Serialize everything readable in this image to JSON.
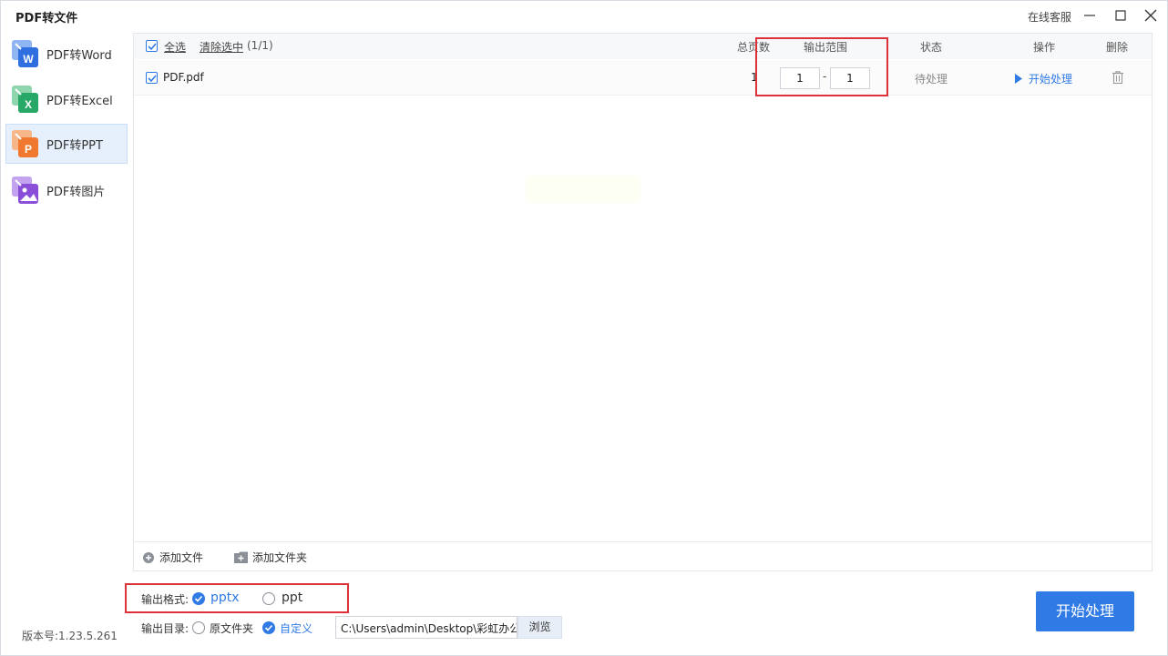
{
  "app": {
    "title": "PDF转文件",
    "support_label": "在线客服",
    "version": "版本号:1.23.5.261"
  },
  "sidebar": {
    "items": [
      {
        "label": "PDF转Word",
        "icon": "word-icon",
        "letter": "W",
        "color": "#2f6fe0",
        "active": false
      },
      {
        "label": "PDF转Excel",
        "icon": "excel-icon",
        "letter": "X",
        "color": "#27a866",
        "active": false
      },
      {
        "label": "PDF转PPT",
        "icon": "ppt-icon",
        "letter": "P",
        "color": "#f0792f",
        "active": true
      },
      {
        "label": "PDF转图片",
        "icon": "image-icon",
        "letter": "",
        "color": "#8a4fd8",
        "active": false
      }
    ]
  },
  "table": {
    "select_all": "全选",
    "clear_selection": "清除选中",
    "selection_count": "(1/1)",
    "columns": {
      "total_pages": "总页数",
      "output_range": "输出范围",
      "status": "状态",
      "action": "操作",
      "delete": "删除"
    },
    "rows": [
      {
        "checked": true,
        "name": "PDF.pdf",
        "pages": "1",
        "range_from": "1",
        "range_sep": "-",
        "range_to": "1",
        "status": "待处理",
        "action": "开始处理"
      }
    ]
  },
  "footer": {
    "add_file": "添加文件",
    "add_folder": "添加文件夹"
  },
  "output": {
    "format_label": "输出格式:",
    "format_options": [
      "pptx",
      "ppt"
    ],
    "format_selected": "pptx",
    "dir_label": "输出目录:",
    "dir_options": [
      "原文件夹",
      "自定义"
    ],
    "dir_selected": "自定义",
    "path": "C:\\Users\\admin\\Desktop\\彩虹办公",
    "browse": "浏览"
  },
  "start_button": "开始处理",
  "colors": {
    "accent": "#2f7ae5",
    "highlight": "#e0313b"
  }
}
